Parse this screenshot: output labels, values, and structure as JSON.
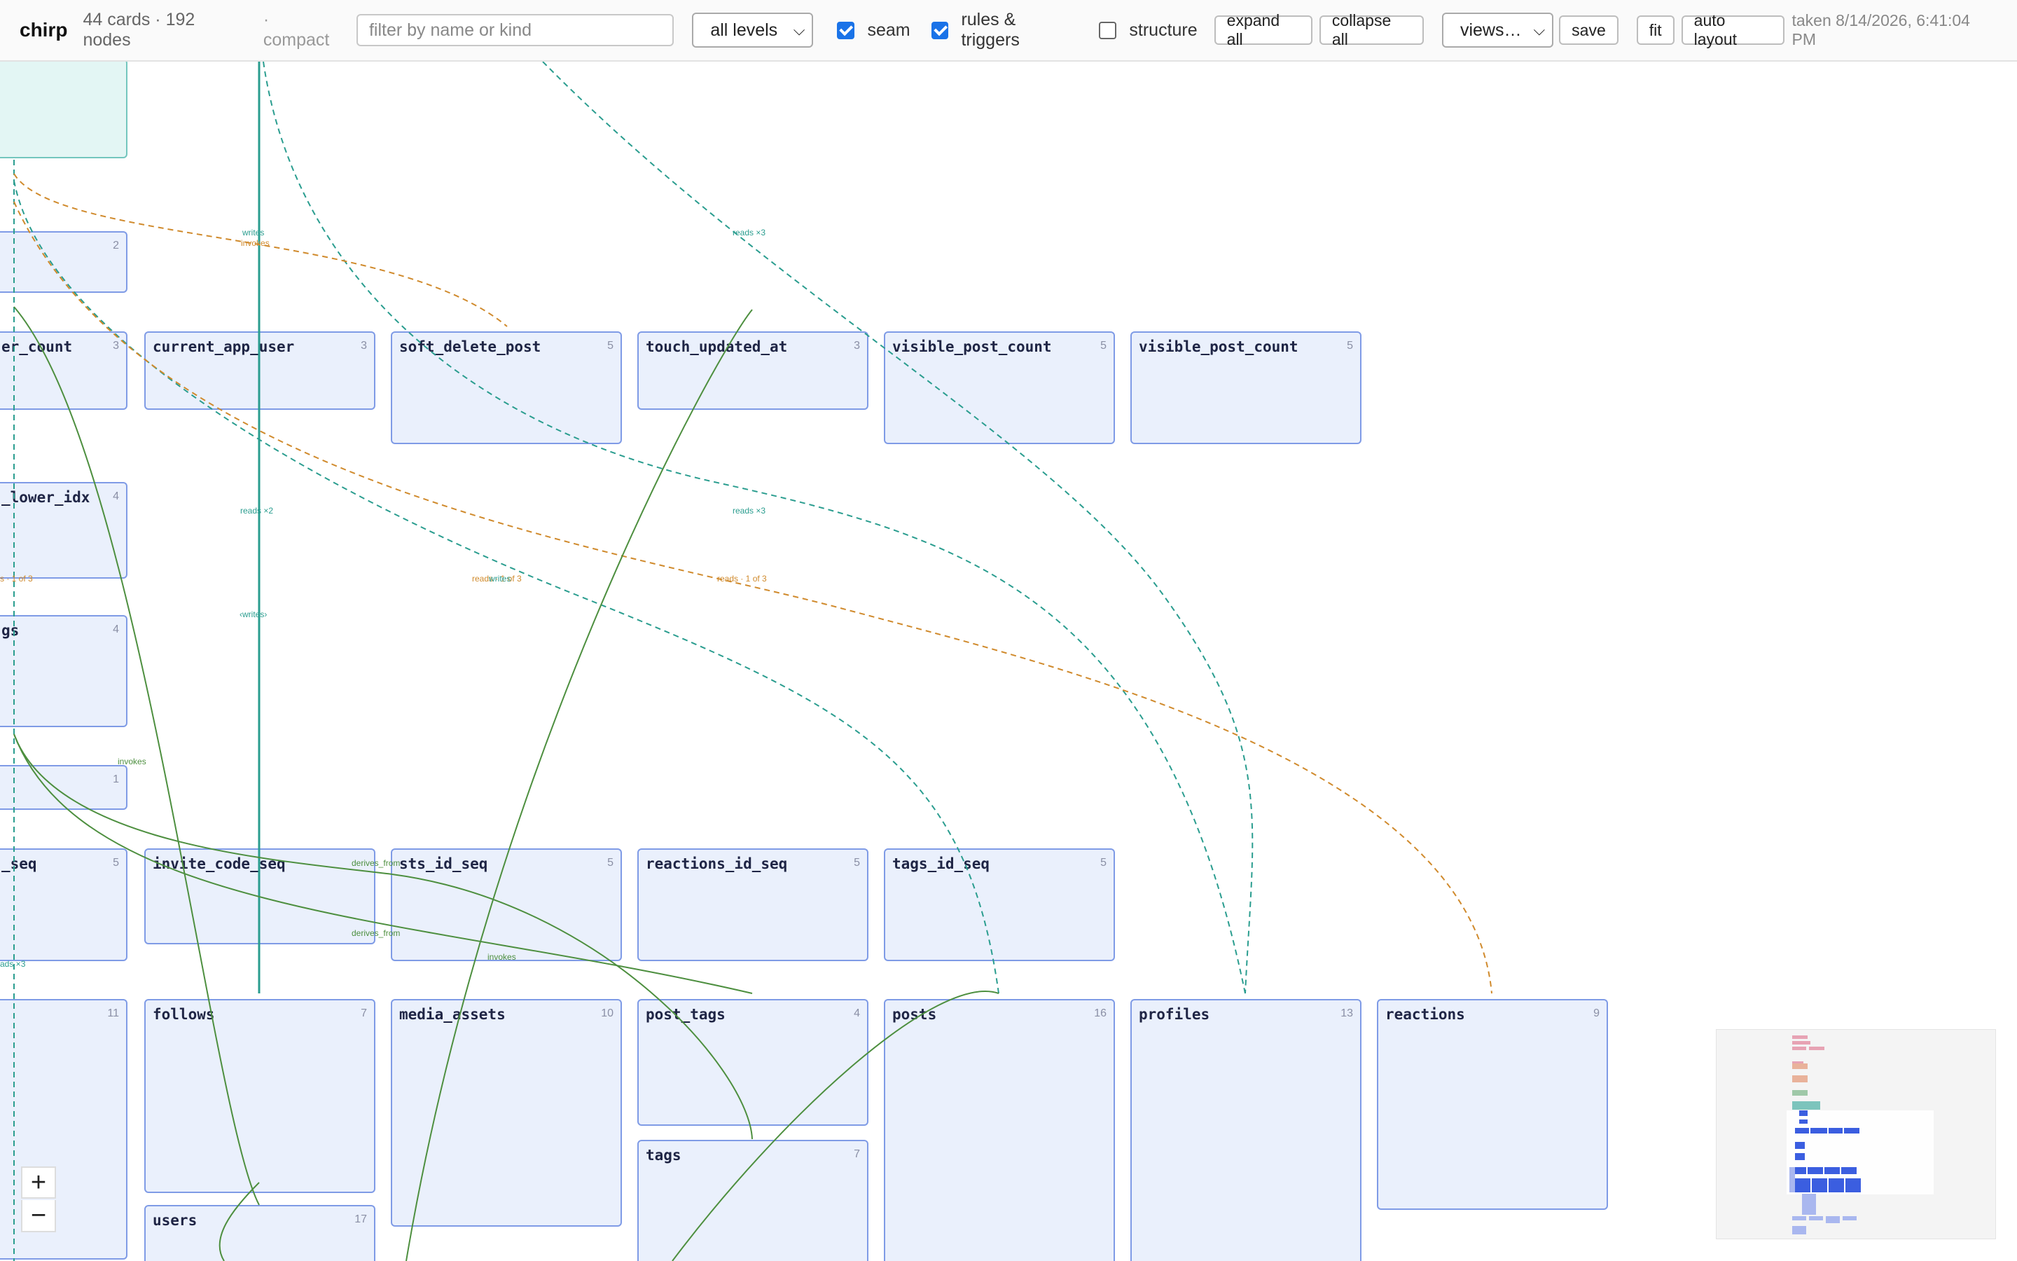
{
  "app": {
    "brand": "chirp",
    "stats": "44 cards · 192 nodes",
    "mode": "· compact",
    "timestamp": "taken 8/14/2026, 6:41:04 PM"
  },
  "toolbar": {
    "filter_placeholder": "filter by name or kind",
    "filter_value": "",
    "levels_select": "all levels",
    "checkbox_seam": {
      "label": "seam",
      "checked": true
    },
    "checkbox_rules": {
      "label": "rules & triggers",
      "checked": true
    },
    "checkbox_structure": {
      "label": "structure",
      "checked": false
    },
    "expand_all": "expand all",
    "collapse_all": "collapse all",
    "views_select": "views…",
    "save": "save",
    "fit": "fit",
    "auto_layout": "auto layout"
  },
  "cards": [
    {
      "name": "",
      "count": "",
      "teal": true
    },
    {
      "name": "",
      "count": "2"
    },
    {
      "name": "er_count",
      "count": "3"
    },
    {
      "name": "current_app_user",
      "count": "3"
    },
    {
      "name": "soft_delete_post",
      "count": "5"
    },
    {
      "name": "touch_updated_at",
      "count": "3"
    },
    {
      "name": "visible_post_count",
      "count": "5"
    },
    {
      "name": "visible_post_count",
      "count": "5"
    },
    {
      "name": "_lower_idx",
      "count": "4"
    },
    {
      "name": "gs",
      "count": "4"
    },
    {
      "name": "",
      "count": "1"
    },
    {
      "name": "_seq",
      "count": "5"
    },
    {
      "name": "invite_code_seq",
      "count": ""
    },
    {
      "name": "sts_id_seq",
      "count": "5"
    },
    {
      "name": "reactions_id_seq",
      "count": "5"
    },
    {
      "name": "tags_id_seq",
      "count": "5"
    },
    {
      "name": "",
      "count": "11"
    },
    {
      "name": "follows",
      "count": "7"
    },
    {
      "name": "media_assets",
      "count": "10"
    },
    {
      "name": "post_tags",
      "count": "4"
    },
    {
      "name": "posts",
      "count": "16"
    },
    {
      "name": "profiles",
      "count": "13"
    },
    {
      "name": "reactions",
      "count": "9"
    },
    {
      "name": "tags",
      "count": "7"
    },
    {
      "name": "users",
      "count": "17"
    }
  ],
  "edge_labels": [
    "writes",
    "invokes",
    "reads ×3",
    "reads ×2",
    "reads ×3",
    "s · 1 of 3",
    "reads · 1 of 3",
    "writes",
    "reads · 1 of 3",
    "‹writes›",
    "invokes",
    "derives_from",
    "derives_from",
    "invokes",
    "ads ×3"
  ],
  "zoom": {
    "in": "+",
    "out": "−"
  },
  "colors": {
    "seam": "#2a9d8f",
    "rule": "#d08a2c",
    "derives": "#4d8f3f",
    "card_border": "#7f9be6",
    "card_bg": "#eaf0fc"
  }
}
